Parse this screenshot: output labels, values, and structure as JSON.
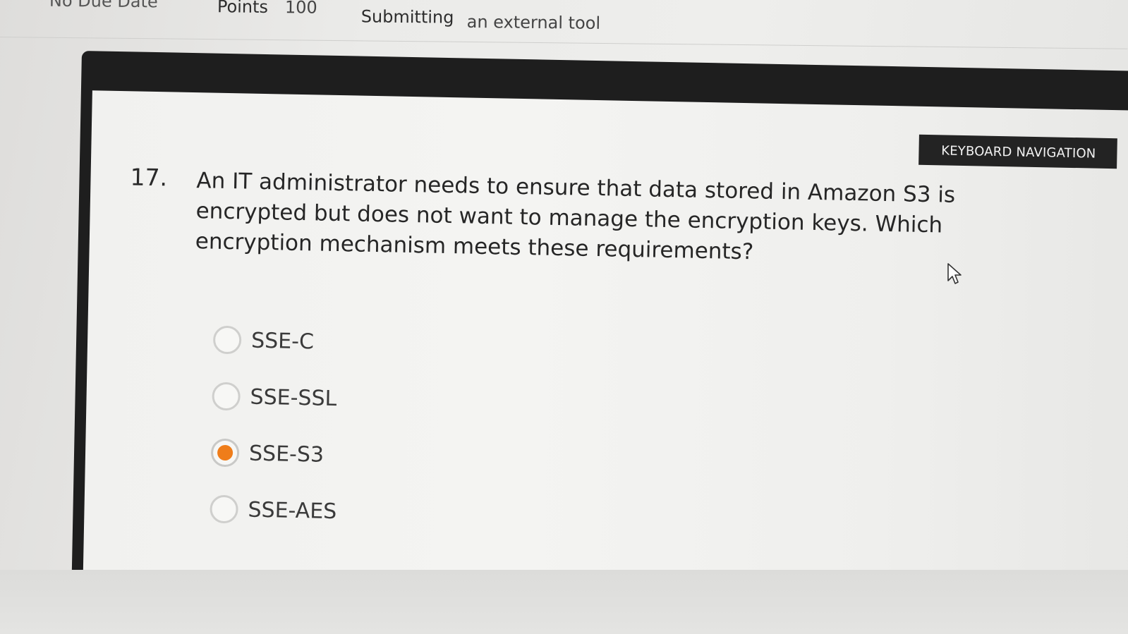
{
  "header": {
    "due_label": "No Due Date",
    "points_label": "Points",
    "points_value": "100",
    "submitting_label": "Submitting",
    "submitting_value": "an external tool"
  },
  "quiz": {
    "keyboard_nav_label": "KEYBOARD NAVIGATION",
    "question_number": "17.",
    "question_text": "An IT administrator needs to ensure that data stored in Amazon S3 is encrypted but does not want to manage the encryption keys. Which encryption mechanism meets these requirements?",
    "options": [
      {
        "label": "SSE-C",
        "selected": false
      },
      {
        "label": "SSE-SSL",
        "selected": false
      },
      {
        "label": "SSE-S3",
        "selected": true
      },
      {
        "label": "SSE-AES",
        "selected": false
      }
    ]
  },
  "colors": {
    "accent": "#ef7d1a",
    "frame": "#1e1e1e",
    "panel": "#f3f3f1"
  },
  "icons": {
    "cursor": "mouse-pointer-icon",
    "radio": "radio-button-icon"
  }
}
